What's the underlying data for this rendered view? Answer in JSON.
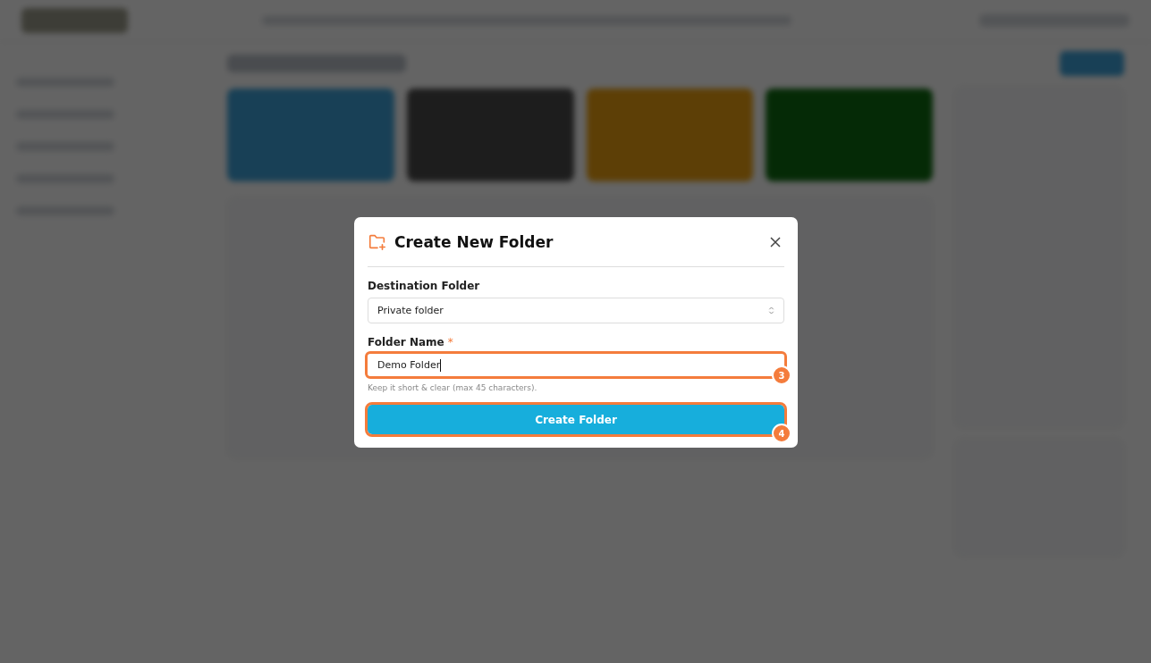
{
  "dialog": {
    "title": "Create New Folder",
    "fields": [
      {
        "kind": "select",
        "label": "Destination Folder",
        "value": "Private folder"
      },
      {
        "kind": "text",
        "label": "Folder Name",
        "required_mark": "*",
        "value": "Demo Folder",
        "hint": "Keep it short & clear (max 45 characters).",
        "highlighted": true,
        "step": "3"
      }
    ],
    "submit": {
      "label": "Create Folder",
      "highlighted": true,
      "step": "4"
    }
  }
}
